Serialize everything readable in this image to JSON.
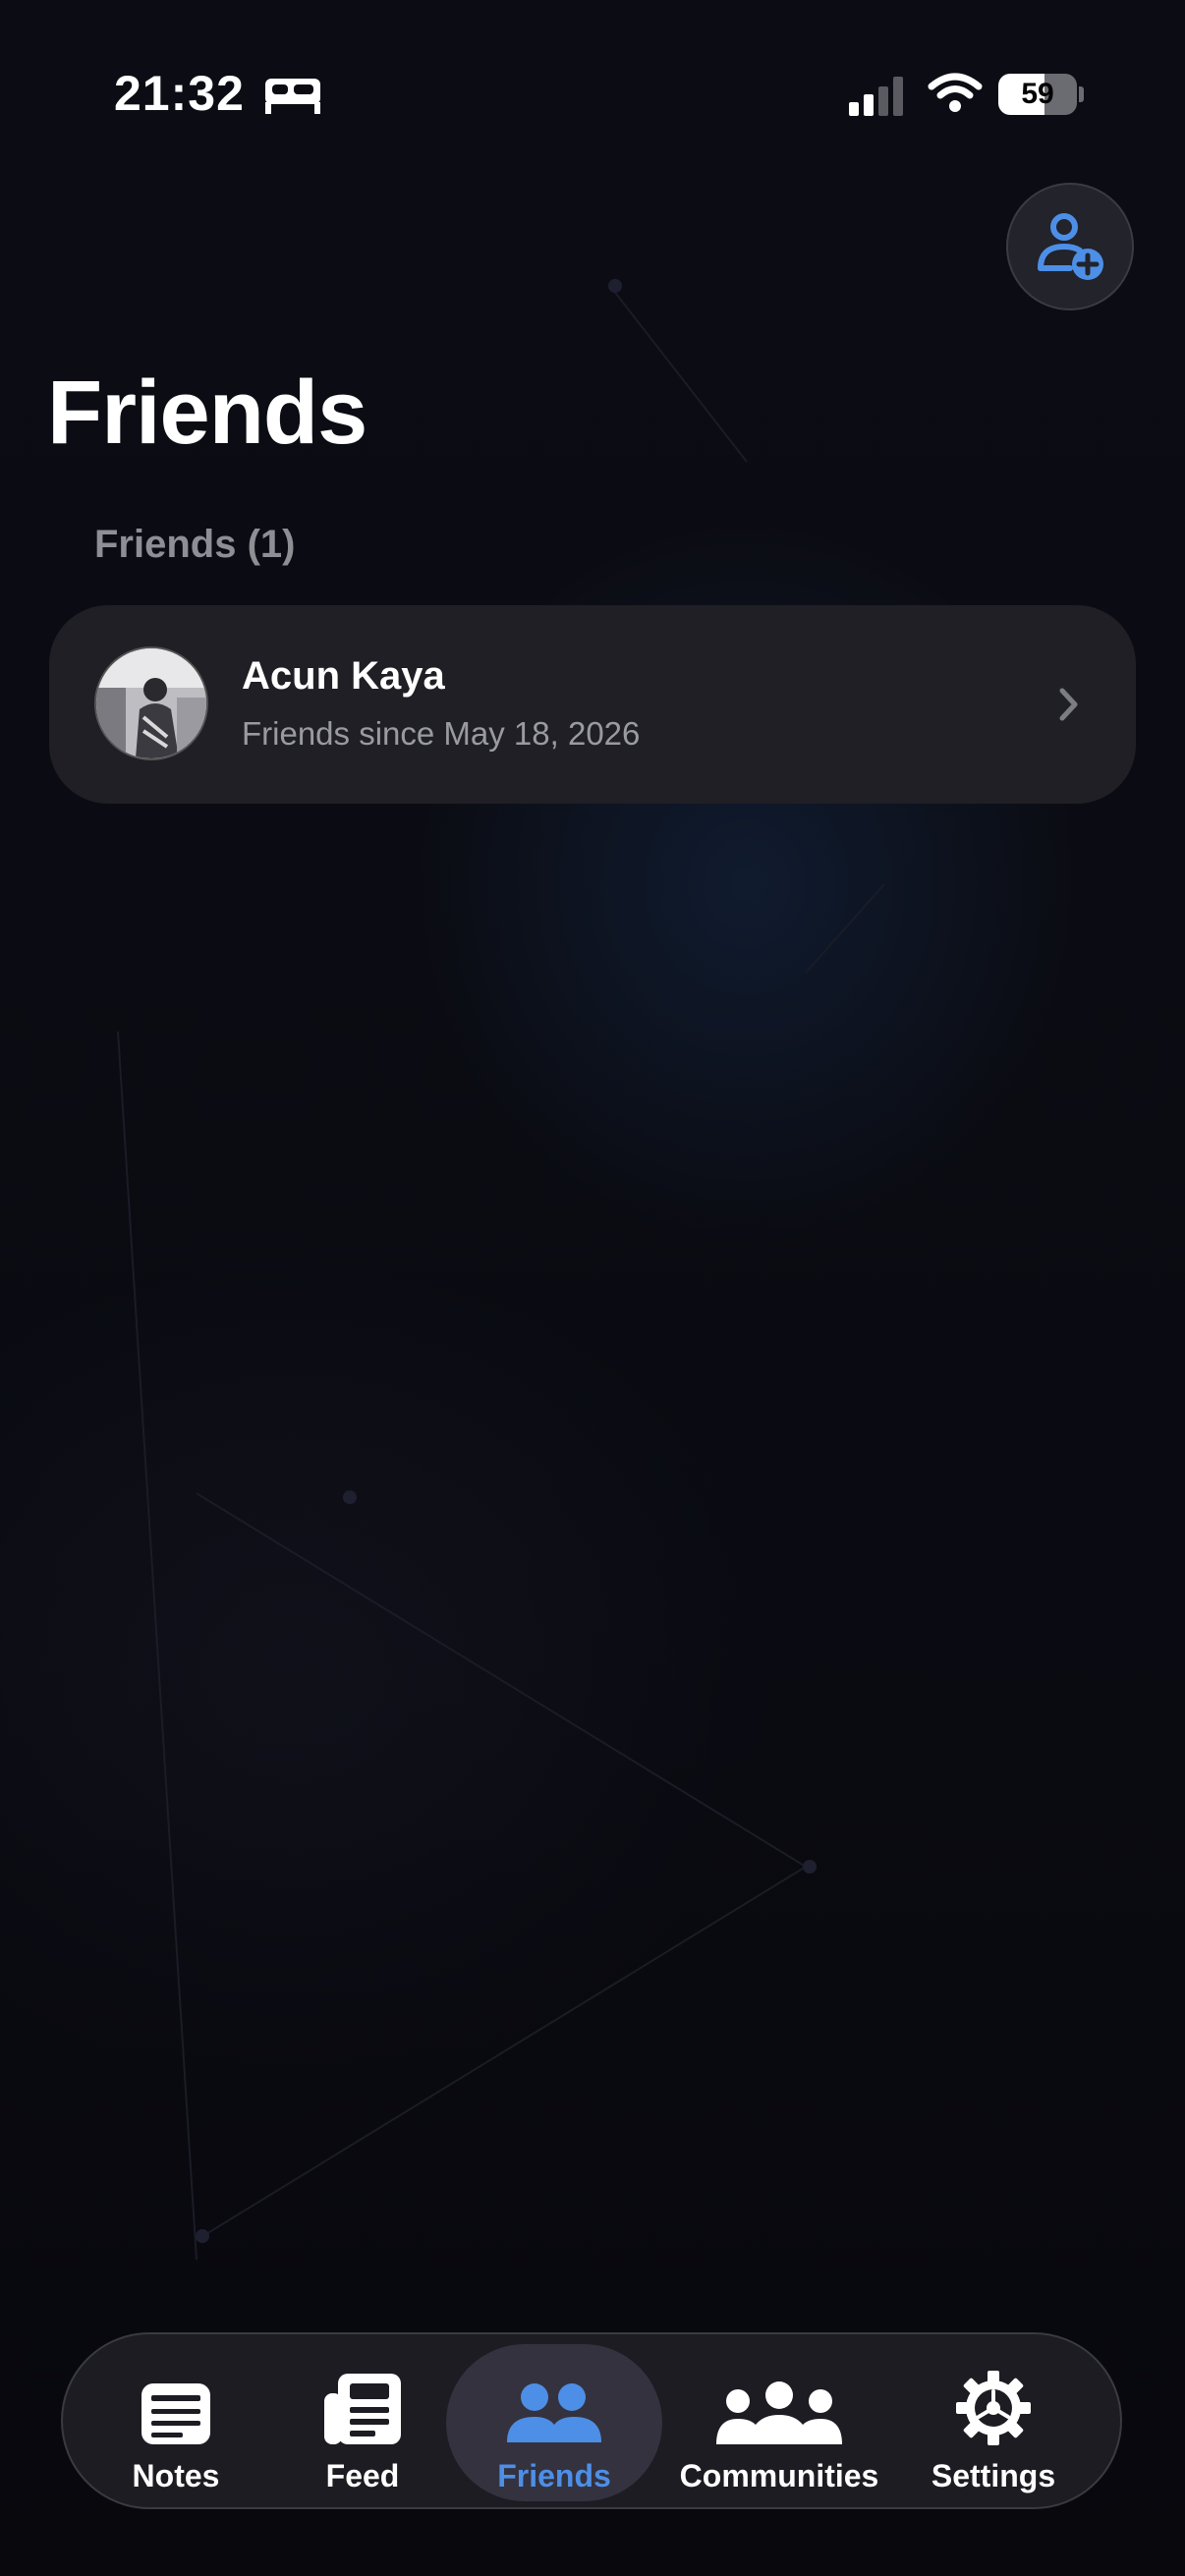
{
  "status_bar": {
    "time": "21:32",
    "battery": "59",
    "icons": [
      "bed-icon",
      "signal-icon",
      "wifi-icon",
      "battery-icon"
    ]
  },
  "header": {
    "title": "Friends",
    "add_friend_icon": "person-add-icon"
  },
  "friends_section": {
    "header": "Friends (1)",
    "items": [
      {
        "name": "Acun Kaya",
        "subtitle": "Friends since May 18, 2026",
        "icon": "chevron-right-icon"
      }
    ]
  },
  "tab_bar": {
    "tabs": [
      {
        "label": "Notes",
        "icon": "notes-icon",
        "active": false
      },
      {
        "label": "Feed",
        "icon": "newspaper-icon",
        "active": false
      },
      {
        "label": "Friends",
        "icon": "friends-icon",
        "active": true
      },
      {
        "label": "Communities",
        "icon": "communities-icon",
        "active": false
      },
      {
        "label": "Settings",
        "icon": "gear-icon",
        "active": false
      }
    ]
  },
  "colors": {
    "accent": "#4d8fe6",
    "background": "#0b0b12",
    "card": "#1f1f25"
  }
}
